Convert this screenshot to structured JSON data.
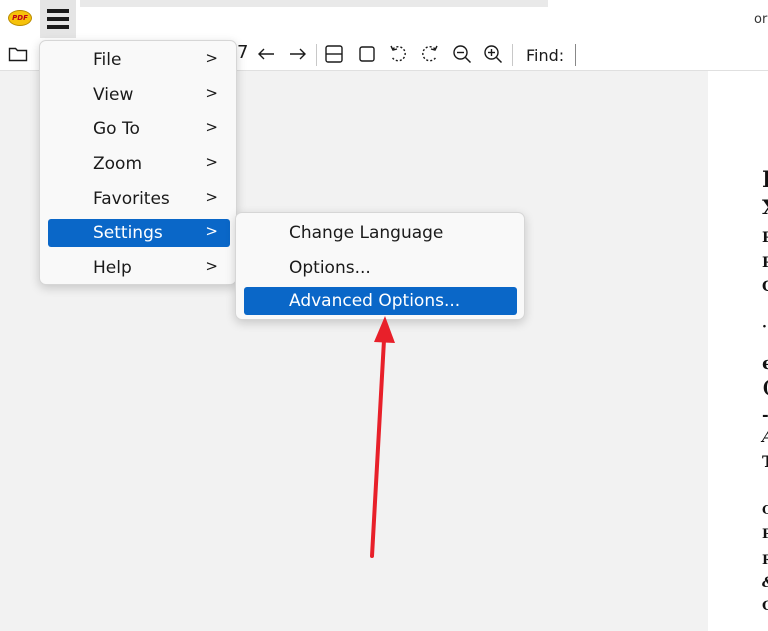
{
  "app": {
    "logo_text": "PDF",
    "title_fragment": "or"
  },
  "toolbar": {
    "page_fragment": "7",
    "find_label": "Find:",
    "icons": [
      "open-folder-icon",
      "back-arrow-icon",
      "forward-arrow-icon",
      "fit-page-icon",
      "fit-width-icon",
      "rotate-left-icon",
      "rotate-right-icon",
      "zoom-out-icon",
      "zoom-in-icon"
    ]
  },
  "main_menu": {
    "items": [
      {
        "label": "File",
        "submenu": ">"
      },
      {
        "label": "View",
        "submenu": ">"
      },
      {
        "label": "Go To",
        "submenu": ">"
      },
      {
        "label": "Zoom",
        "submenu": ">"
      },
      {
        "label": "Favorites",
        "submenu": ">"
      },
      {
        "label": "Settings",
        "submenu": ">"
      },
      {
        "label": "Help",
        "submenu": ">"
      }
    ],
    "active_index": 5
  },
  "settings_submenu": {
    "items": [
      {
        "label": "Change Language"
      },
      {
        "label": "Options..."
      },
      {
        "label": "Advanced Options..."
      }
    ],
    "active_index": 2
  },
  "document": {
    "visible_fragments": [
      "I",
      "X",
      "R",
      "R",
      "C",
      "·",
      "e",
      "(",
      "-",
      "A",
      "T",
      "C",
      "P",
      "R",
      "&",
      "C"
    ]
  },
  "colors": {
    "highlight": "#0a67c8",
    "annotation_arrow": "#e8202a"
  }
}
